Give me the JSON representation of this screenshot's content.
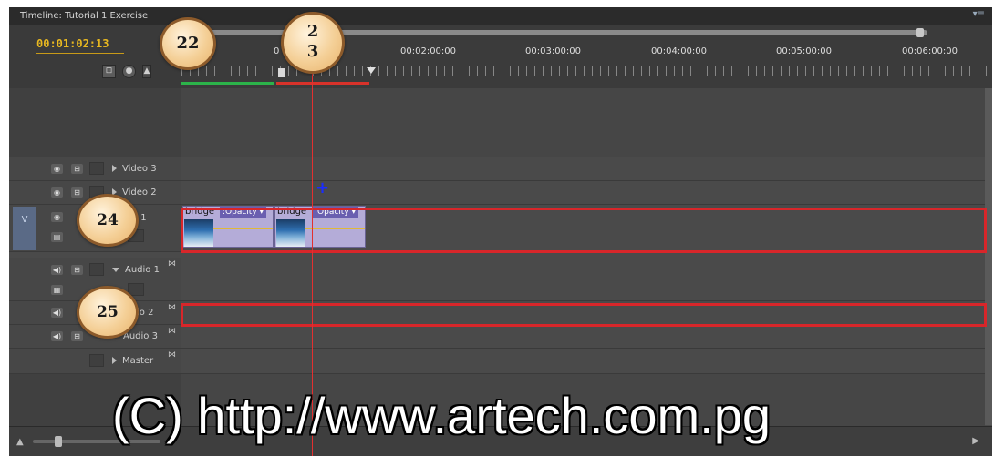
{
  "window": {
    "title": "Timeline: Tutorial 1 Exercise",
    "menu_icon": "panel-menu-icon"
  },
  "header": {
    "timecode": "00:01:02:13",
    "ruler_labels": [
      "0",
      "00:02:00:00",
      "00:03:00:00",
      "00:04:00:00",
      "00:05:00:00",
      "00:06:00:00"
    ]
  },
  "tracks": {
    "video3": {
      "name": "Video 3"
    },
    "video2": {
      "name": "Video 2"
    },
    "video1": {
      "name": "o 1",
      "target": "V"
    },
    "audio1": {
      "name": "Audio 1"
    },
    "audio2": {
      "name": "io 2"
    },
    "audio3": {
      "name": "Audio 3"
    },
    "master": {
      "name": "Master"
    }
  },
  "clips": [
    {
      "name": "bridge",
      "effect": ":Opacity ▾"
    },
    {
      "name": "bridge",
      "effect": ":Opacity ▾"
    }
  ],
  "callouts": {
    "c22": "22",
    "c23_line1": "2",
    "c23_line2": "3",
    "c24": "24",
    "c25": "25"
  },
  "watermark": "(C) http://www.artech.com.pg",
  "colors": {
    "timecode": "#e8b820",
    "playhead": "#e23030",
    "highlight_box": "#d8262a",
    "clip": "#b4acd8"
  }
}
